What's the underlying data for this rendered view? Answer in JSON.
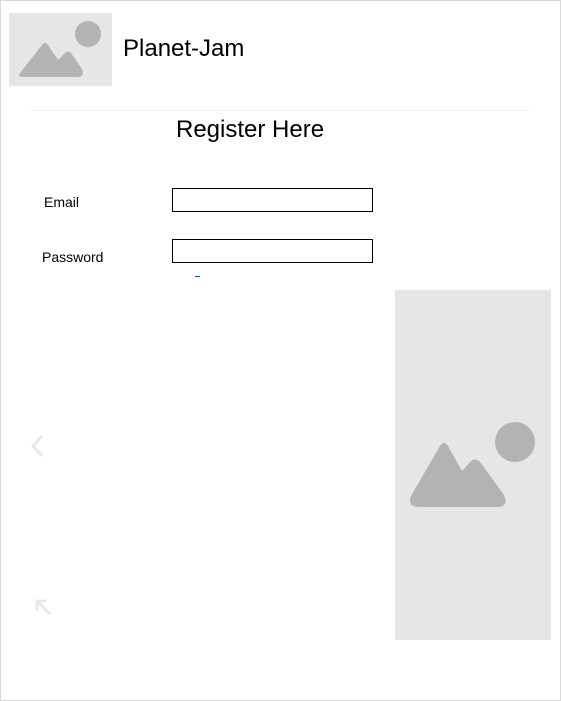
{
  "header": {
    "app_title": "Planet-Jam",
    "logo_icon": "image-placeholder-icon"
  },
  "form": {
    "title": "Register Here",
    "email_label": "Email",
    "email_value": "",
    "password_label": "Password",
    "password_value": ""
  },
  "media": {
    "side_image_icon": "image-placeholder-icon",
    "prev_icon": "chevron-left-icon",
    "expand_icon": "arrow-up-left-icon"
  },
  "colors": {
    "placeholder_bg": "#e6e6e6",
    "placeholder_shape": "#b3b3b3",
    "faint_icon": "#e8e8e8",
    "link": "#1a4fd6"
  }
}
